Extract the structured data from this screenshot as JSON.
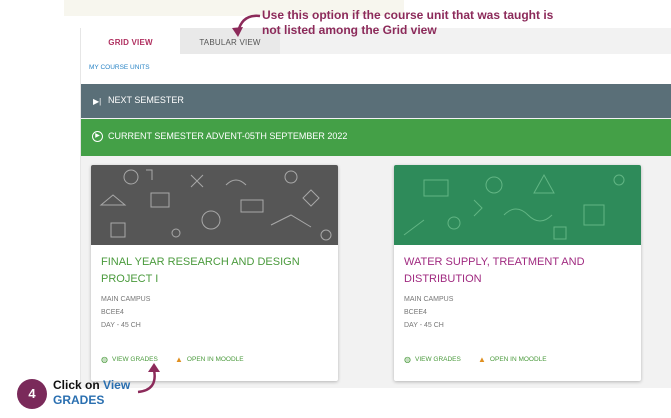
{
  "tabs": {
    "active": "GRID VIEW",
    "inactive": "TABULAR VIEW"
  },
  "breadcrumb": "MY COURSE UNITS",
  "next_semester": "NEXT SEMESTER",
  "current_semester": "CURRENT SEMESTER ADVENT-05TH SEPTEMBER 2022",
  "cards": [
    {
      "title": "FINAL YEAR RESEARCH AND DESIGN PROJECT I",
      "campus": "MAIN CAMPUS",
      "code": "BCEE4",
      "session": "DAY - 45 CH",
      "view_grades": "VIEW GRADES",
      "open_moodle": "OPEN IN MOODLE"
    },
    {
      "title": "WATER SUPPLY, TREATMENT AND DISTRIBUTION",
      "campus": "MAIN CAMPUS",
      "code": "BCEE4",
      "session": "DAY - 45 CH",
      "view_grades": "VIEW GRADES",
      "open_moodle": "OPEN IN MOODLE"
    }
  ],
  "annotations": {
    "top_note": "Use this option if the course unit that was taught is not listed among the Grid view",
    "step_number": "4",
    "step_click": "Click on",
    "step_view": "View",
    "step_grades": "GRADES"
  },
  "colors": {
    "accent": "#b03060",
    "next_bar": "#5a6f78",
    "current_bar": "#44a047",
    "title_green": "#4a9a3c",
    "title_purple": "#a02a80",
    "annotation": "#8c2a5a"
  }
}
